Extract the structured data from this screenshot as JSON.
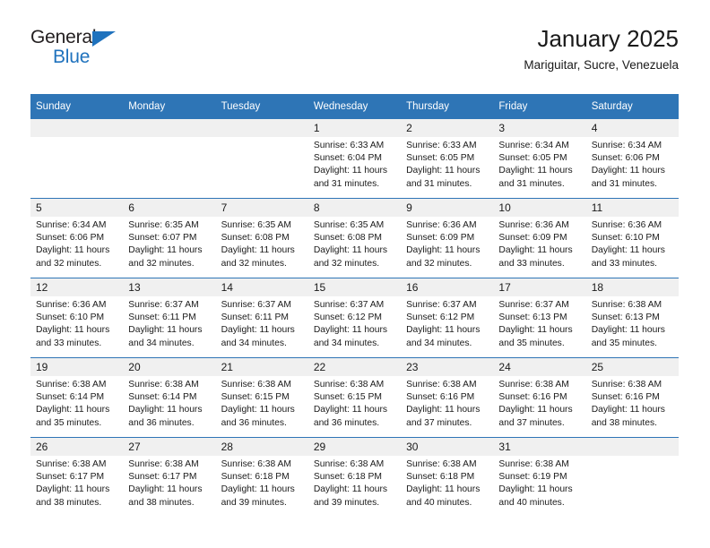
{
  "brand": {
    "name_part1": "General",
    "name_part2": "Blue",
    "triangle_color": "#1f72bd",
    "text_color": "#231f20"
  },
  "header": {
    "title": "January 2025",
    "subtitle": "Mariguitar, Sucre, Venezuela"
  },
  "theme": {
    "header_blue": "#2e75b6",
    "daynum_bg": "#f0f0f0",
    "text": "#1a1a1a"
  },
  "calendar": {
    "weekday_headers": [
      "Sunday",
      "Monday",
      "Tuesday",
      "Wednesday",
      "Thursday",
      "Friday",
      "Saturday"
    ],
    "labels": {
      "sunrise": "Sunrise:",
      "sunset": "Sunset:",
      "daylight": "Daylight:"
    },
    "weeks": [
      [
        {
          "day": "",
          "blank": true
        },
        {
          "day": "",
          "blank": true
        },
        {
          "day": "",
          "blank": true
        },
        {
          "day": "1",
          "sunrise": "Sunrise: 6:33 AM",
          "sunset": "Sunset: 6:04 PM",
          "daylight": "Daylight: 11 hours and 31 minutes."
        },
        {
          "day": "2",
          "sunrise": "Sunrise: 6:33 AM",
          "sunset": "Sunset: 6:05 PM",
          "daylight": "Daylight: 11 hours and 31 minutes."
        },
        {
          "day": "3",
          "sunrise": "Sunrise: 6:34 AM",
          "sunset": "Sunset: 6:05 PM",
          "daylight": "Daylight: 11 hours and 31 minutes."
        },
        {
          "day": "4",
          "sunrise": "Sunrise: 6:34 AM",
          "sunset": "Sunset: 6:06 PM",
          "daylight": "Daylight: 11 hours and 31 minutes."
        }
      ],
      [
        {
          "day": "5",
          "sunrise": "Sunrise: 6:34 AM",
          "sunset": "Sunset: 6:06 PM",
          "daylight": "Daylight: 11 hours and 32 minutes."
        },
        {
          "day": "6",
          "sunrise": "Sunrise: 6:35 AM",
          "sunset": "Sunset: 6:07 PM",
          "daylight": "Daylight: 11 hours and 32 minutes."
        },
        {
          "day": "7",
          "sunrise": "Sunrise: 6:35 AM",
          "sunset": "Sunset: 6:08 PM",
          "daylight": "Daylight: 11 hours and 32 minutes."
        },
        {
          "day": "8",
          "sunrise": "Sunrise: 6:35 AM",
          "sunset": "Sunset: 6:08 PM",
          "daylight": "Daylight: 11 hours and 32 minutes."
        },
        {
          "day": "9",
          "sunrise": "Sunrise: 6:36 AM",
          "sunset": "Sunset: 6:09 PM",
          "daylight": "Daylight: 11 hours and 32 minutes."
        },
        {
          "day": "10",
          "sunrise": "Sunrise: 6:36 AM",
          "sunset": "Sunset: 6:09 PM",
          "daylight": "Daylight: 11 hours and 33 minutes."
        },
        {
          "day": "11",
          "sunrise": "Sunrise: 6:36 AM",
          "sunset": "Sunset: 6:10 PM",
          "daylight": "Daylight: 11 hours and 33 minutes."
        }
      ],
      [
        {
          "day": "12",
          "sunrise": "Sunrise: 6:36 AM",
          "sunset": "Sunset: 6:10 PM",
          "daylight": "Daylight: 11 hours and 33 minutes."
        },
        {
          "day": "13",
          "sunrise": "Sunrise: 6:37 AM",
          "sunset": "Sunset: 6:11 PM",
          "daylight": "Daylight: 11 hours and 34 minutes."
        },
        {
          "day": "14",
          "sunrise": "Sunrise: 6:37 AM",
          "sunset": "Sunset: 6:11 PM",
          "daylight": "Daylight: 11 hours and 34 minutes."
        },
        {
          "day": "15",
          "sunrise": "Sunrise: 6:37 AM",
          "sunset": "Sunset: 6:12 PM",
          "daylight": "Daylight: 11 hours and 34 minutes."
        },
        {
          "day": "16",
          "sunrise": "Sunrise: 6:37 AM",
          "sunset": "Sunset: 6:12 PM",
          "daylight": "Daylight: 11 hours and 34 minutes."
        },
        {
          "day": "17",
          "sunrise": "Sunrise: 6:37 AM",
          "sunset": "Sunset: 6:13 PM",
          "daylight": "Daylight: 11 hours and 35 minutes."
        },
        {
          "day": "18",
          "sunrise": "Sunrise: 6:38 AM",
          "sunset": "Sunset: 6:13 PM",
          "daylight": "Daylight: 11 hours and 35 minutes."
        }
      ],
      [
        {
          "day": "19",
          "sunrise": "Sunrise: 6:38 AM",
          "sunset": "Sunset: 6:14 PM",
          "daylight": "Daylight: 11 hours and 35 minutes."
        },
        {
          "day": "20",
          "sunrise": "Sunrise: 6:38 AM",
          "sunset": "Sunset: 6:14 PM",
          "daylight": "Daylight: 11 hours and 36 minutes."
        },
        {
          "day": "21",
          "sunrise": "Sunrise: 6:38 AM",
          "sunset": "Sunset: 6:15 PM",
          "daylight": "Daylight: 11 hours and 36 minutes."
        },
        {
          "day": "22",
          "sunrise": "Sunrise: 6:38 AM",
          "sunset": "Sunset: 6:15 PM",
          "daylight": "Daylight: 11 hours and 36 minutes."
        },
        {
          "day": "23",
          "sunrise": "Sunrise: 6:38 AM",
          "sunset": "Sunset: 6:16 PM",
          "daylight": "Daylight: 11 hours and 37 minutes."
        },
        {
          "day": "24",
          "sunrise": "Sunrise: 6:38 AM",
          "sunset": "Sunset: 6:16 PM",
          "daylight": "Daylight: 11 hours and 37 minutes."
        },
        {
          "day": "25",
          "sunrise": "Sunrise: 6:38 AM",
          "sunset": "Sunset: 6:16 PM",
          "daylight": "Daylight: 11 hours and 38 minutes."
        }
      ],
      [
        {
          "day": "26",
          "sunrise": "Sunrise: 6:38 AM",
          "sunset": "Sunset: 6:17 PM",
          "daylight": "Daylight: 11 hours and 38 minutes."
        },
        {
          "day": "27",
          "sunrise": "Sunrise: 6:38 AM",
          "sunset": "Sunset: 6:17 PM",
          "daylight": "Daylight: 11 hours and 38 minutes."
        },
        {
          "day": "28",
          "sunrise": "Sunrise: 6:38 AM",
          "sunset": "Sunset: 6:18 PM",
          "daylight": "Daylight: 11 hours and 39 minutes."
        },
        {
          "day": "29",
          "sunrise": "Sunrise: 6:38 AM",
          "sunset": "Sunset: 6:18 PM",
          "daylight": "Daylight: 11 hours and 39 minutes."
        },
        {
          "day": "30",
          "sunrise": "Sunrise: 6:38 AM",
          "sunset": "Sunset: 6:18 PM",
          "daylight": "Daylight: 11 hours and 40 minutes."
        },
        {
          "day": "31",
          "sunrise": "Sunrise: 6:38 AM",
          "sunset": "Sunset: 6:19 PM",
          "daylight": "Daylight: 11 hours and 40 minutes."
        },
        {
          "day": "",
          "blank": true
        }
      ]
    ]
  }
}
